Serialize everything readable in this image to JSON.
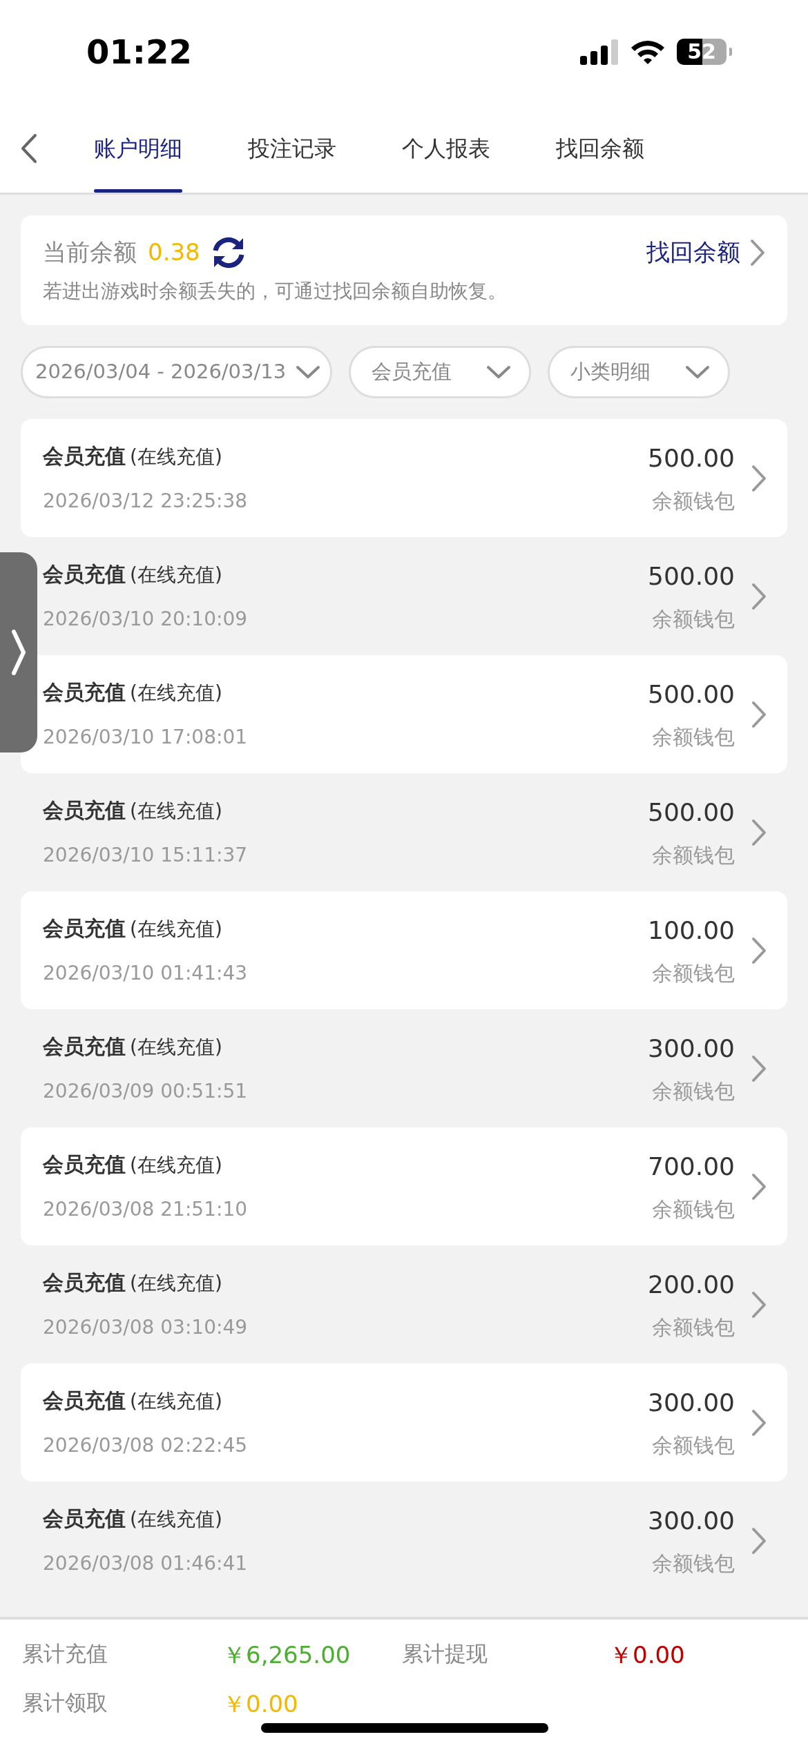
{
  "status_bar": {
    "time": "01:22",
    "battery": "52"
  },
  "tabs": [
    {
      "label": "账户明细",
      "selected": true
    },
    {
      "label": "投注记录",
      "selected": false
    },
    {
      "label": "个人报表",
      "selected": false
    },
    {
      "label": "找回余额",
      "selected": false
    }
  ],
  "balance_card": {
    "label": "当前余额",
    "value": "0.38",
    "link": "找回余额",
    "hint": "若进出游戏时余额丢失的，可通过找回余额自助恢复。"
  },
  "filters": [
    {
      "value": "2026/03/04 - 2026/03/13"
    },
    {
      "value": "会员充值"
    },
    {
      "value": "小类明细"
    }
  ],
  "records": [
    {
      "title": "会员充值",
      "subtitle": "(在线充值)",
      "time": "2026/03/12 23:25:38",
      "amount": "500.00",
      "wallet": "余额钱包"
    },
    {
      "title": "会员充值",
      "subtitle": "(在线充值)",
      "time": "2026/03/10 20:10:09",
      "amount": "500.00",
      "wallet": "余额钱包"
    },
    {
      "title": "会员充值",
      "subtitle": "(在线充值)",
      "time": "2026/03/10 17:08:01",
      "amount": "500.00",
      "wallet": "余额钱包"
    },
    {
      "title": "会员充值",
      "subtitle": "(在线充值)",
      "time": "2026/03/10 15:11:37",
      "amount": "500.00",
      "wallet": "余额钱包"
    },
    {
      "title": "会员充值",
      "subtitle": "(在线充值)",
      "time": "2026/03/10 01:41:43",
      "amount": "100.00",
      "wallet": "余额钱包"
    },
    {
      "title": "会员充值",
      "subtitle": "(在线充值)",
      "time": "2026/03/09 00:51:51",
      "amount": "300.00",
      "wallet": "余额钱包"
    },
    {
      "title": "会员充值",
      "subtitle": "(在线充值)",
      "time": "2026/03/08 21:51:10",
      "amount": "700.00",
      "wallet": "余额钱包"
    },
    {
      "title": "会员充值",
      "subtitle": "(在线充值)",
      "time": "2026/03/08 03:10:49",
      "amount": "200.00",
      "wallet": "余额钱包"
    },
    {
      "title": "会员充值",
      "subtitle": "(在线充值)",
      "time": "2026/03/08 02:22:45",
      "amount": "300.00",
      "wallet": "余额钱包"
    },
    {
      "title": "会员充值",
      "subtitle": "(在线充值)",
      "time": "2026/03/08 01:46:41",
      "amount": "300.00",
      "wallet": "余额钱包"
    }
  ],
  "summary": [
    {
      "label": "累计充值",
      "value": "￥6,265.00",
      "color": "#4caf32"
    },
    {
      "label": "累计提现",
      "value": "￥0.00",
      "color": "#c00000"
    },
    {
      "label": "累计领取",
      "value": "￥0.00",
      "color": "#f5b800"
    }
  ]
}
